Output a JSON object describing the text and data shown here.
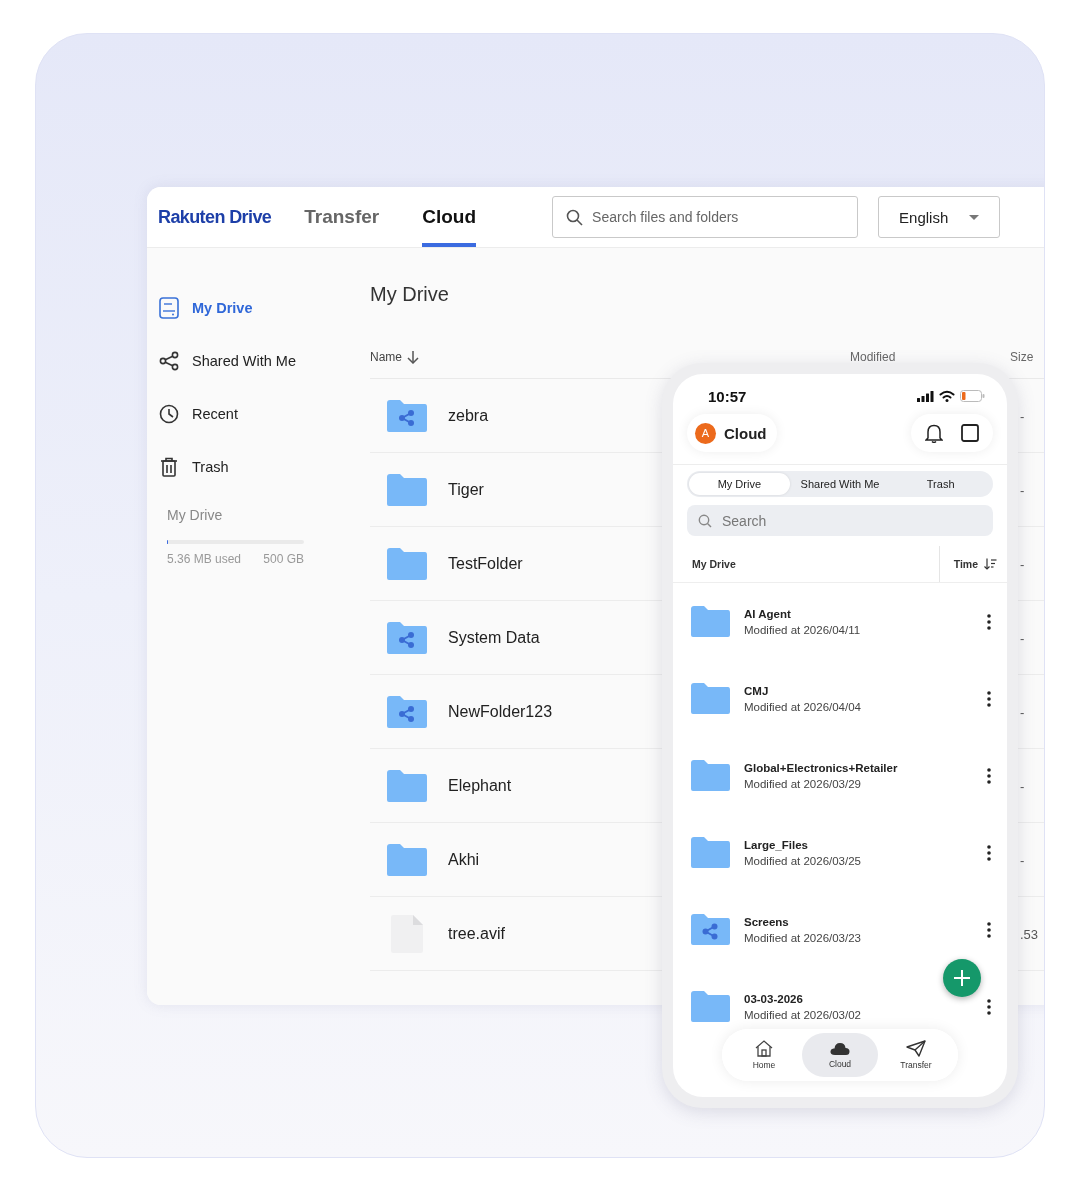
{
  "desktop": {
    "logo": "Rakuten Drive",
    "nav_tabs": [
      {
        "label": "Transfer",
        "selected": false
      },
      {
        "label": "Cloud",
        "selected": true
      }
    ],
    "search": {
      "placeholder": "Search files and folders"
    },
    "language": {
      "value": "English"
    },
    "sidebar": {
      "items": [
        {
          "label": "My Drive",
          "kind": "drive",
          "selected": true
        },
        {
          "label": "Shared With Me",
          "kind": "shared",
          "selected": false
        },
        {
          "label": "Recent",
          "kind": "recent",
          "selected": false
        },
        {
          "label": "Trash",
          "kind": "trash",
          "selected": false
        }
      ]
    },
    "storage": {
      "title": "My Drive",
      "level": 0.01,
      "used": "5.36 MB used",
      "total": "500 GB"
    },
    "page_title": "My Drive",
    "table": {
      "columns": [
        {
          "label": "Name",
          "sorted": true
        },
        {
          "label": "Modified",
          "sorted": false
        },
        {
          "label": "Size",
          "sorted": false
        }
      ],
      "rows": [
        {
          "name": "zebra",
          "kind": "shared_folder",
          "size": "-"
        },
        {
          "name": "Tiger",
          "kind": "folder",
          "size": "-"
        },
        {
          "name": "TestFolder",
          "kind": "folder",
          "size": "-"
        },
        {
          "name": "System Data",
          "kind": "shared_folder",
          "size": "-"
        },
        {
          "name": "NewFolder123",
          "kind": "shared_folder",
          "size": "-"
        },
        {
          "name": "Elephant",
          "kind": "folder",
          "size": "-"
        },
        {
          "name": "Akhi",
          "kind": "folder",
          "size": "-"
        },
        {
          "name": "tree.avif",
          "kind": "file",
          "size": ".53"
        }
      ]
    }
  },
  "phone": {
    "status_bar": {
      "time": "10:57"
    },
    "header": {
      "avatar": "A",
      "title": "Cloud"
    },
    "segments": [
      {
        "label": "My Drive",
        "selected": true
      },
      {
        "label": "Shared With Me",
        "selected": false
      },
      {
        "label": "Trash",
        "selected": false
      }
    ],
    "search": {
      "placeholder": "Search"
    },
    "list_header": {
      "title": "My Drive",
      "sort": "Time"
    },
    "items": [
      {
        "name": "AI Agent",
        "modified": "Modified at 2026/04/11",
        "kind": "folder"
      },
      {
        "name": "CMJ",
        "modified": "Modified at 2026/04/04",
        "kind": "folder"
      },
      {
        "name": "Global+Electronics+Retailer",
        "modified": "Modified at 2026/03/29",
        "kind": "folder"
      },
      {
        "name": "Large_Files",
        "modified": "Modified at 2026/03/25",
        "kind": "folder"
      },
      {
        "name": "Screens",
        "modified": "Modified at 2026/03/23",
        "kind": "shared_folder"
      },
      {
        "name": "03-03-2026",
        "modified": "Modified at 2026/03/02",
        "kind": "folder"
      }
    ],
    "bottom_nav": [
      {
        "label": "Home",
        "kind": "home",
        "selected": false
      },
      {
        "label": "Cloud",
        "kind": "cloud",
        "selected": true
      },
      {
        "label": "Transfer",
        "kind": "transfer",
        "selected": false
      }
    ]
  }
}
